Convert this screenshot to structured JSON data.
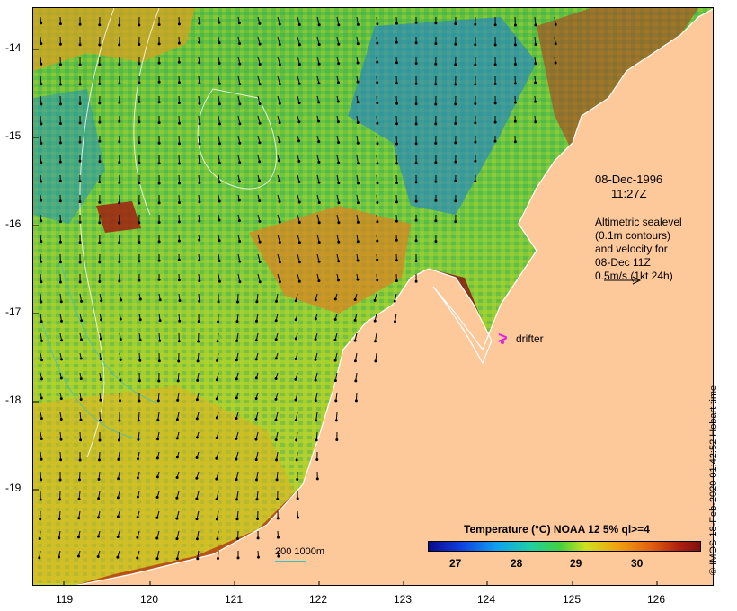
{
  "map": {
    "date": "08-Dec-1996",
    "time": "11:27Z",
    "legend_lines": [
      "Altimetric sealevel",
      "(0.1m contours)",
      "and velocity for",
      "08-Dec 11Z",
      "0.5m/s (1kt 24h)"
    ],
    "drifter_label": "drifter",
    "drifter_color": "#e020e0",
    "bathymetry_label": "200  1000m",
    "credit": "© IMOS 18-Feb-2020 01:42:52 Hobart time",
    "colorbar_title": "Temperature (°C) NOAA 12 5% ql>=4",
    "colorbar_ticks": [
      "27",
      "28",
      "29",
      "30"
    ],
    "lat_ticks": [
      "-14",
      "-15",
      "-16",
      "-17",
      "-18",
      "-19"
    ],
    "lon_ticks": [
      "119",
      "120",
      "121",
      "122",
      "123",
      "124",
      "125",
      "126"
    ],
    "land_color": "#fdc89a",
    "coast_color": "#ffffff"
  }
}
